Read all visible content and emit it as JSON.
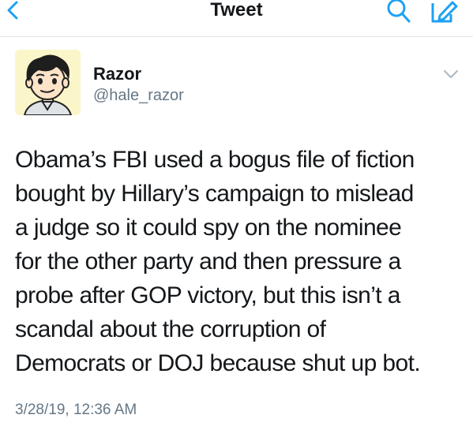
{
  "nav": {
    "title": "Tweet",
    "back_icon": "chevron-left-icon",
    "search_icon": "search-icon",
    "compose_icon": "compose-icon",
    "accent_color": "#1da1f2"
  },
  "author": {
    "name": "Razor",
    "handle": "@hale_razor",
    "avatar_icon": "cartoon-avatar",
    "menu_icon": "chevron-down-icon"
  },
  "tweet": {
    "text": "Obama’s FBI used a bogus file of fiction\nbought by Hillary’s campaign to mislead\na judge so it could spy on the nominee\nfor the other party and then pressure a\nprobe after GOP victory, but this isn’t a\nscandal about the corruption of\nDemocrats or DOJ because shut up bot.",
    "timestamp": "3/28/19, 12:36 AM"
  },
  "colors": {
    "text": "#14171a",
    "secondary": "#657786",
    "divider": "#e1e8ed"
  }
}
